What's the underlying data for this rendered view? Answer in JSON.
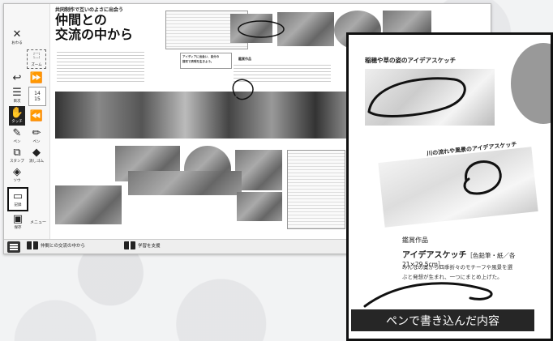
{
  "sidebar": {
    "close_label": "おわる",
    "tools": [
      {
        "name": "frame-tool",
        "label": "ズーム"
      },
      {
        "name": "page-back",
        "label": ""
      },
      {
        "name": "page-forward",
        "label": ""
      },
      {
        "name": "toc-button",
        "label": "目次"
      },
      {
        "name": "page-number",
        "label": "14\n15"
      },
      {
        "name": "touch-tool",
        "label": "タッチ"
      },
      {
        "name": "page-prev",
        "label": ""
      },
      {
        "name": "pen-tool",
        "label": "ペン"
      },
      {
        "name": "marker-tool",
        "label": "ペン"
      },
      {
        "name": "stamp-tool",
        "label": "スタンプ"
      },
      {
        "name": "eraser-tool",
        "label": "消しゴム"
      },
      {
        "name": "layer-tool",
        "label": "ソウ"
      },
      {
        "name": "record-tool",
        "label": "記録"
      },
      {
        "name": "save-tool",
        "label": "保存"
      },
      {
        "name": "menu-tool",
        "label": "メニュー"
      }
    ],
    "page_top": "14",
    "page_bottom": "15"
  },
  "page": {
    "kicker": "共同制作で互いのよさに出会う",
    "title_line1": "仲間との",
    "title_line2": "交流の中から",
    "section_label": "鑑賞作品",
    "callout": "アイディアに出会い、自分の",
    "callout2": "描写で表現を生きよう。"
  },
  "bottombar": {
    "item1": "仲間との交流の中から",
    "item2": "学習を支援"
  },
  "overlay": {
    "heading1": "稲穂や草の姿のアイデアスケッチ",
    "heading2": "川の流れや風景のアイデアスケッチ",
    "work_label": "鑑賞作品",
    "work_title": "アイデアスケッチ",
    "work_meta": "［色鉛筆・紙／各21×29.5cm］",
    "desc1": "みんなの案から四季折々のモチーフや風景を選",
    "desc2": "ぶと発想が生まれ、一つにまとめ上げた。",
    "caption": "ペンで書き込んだ内容"
  }
}
